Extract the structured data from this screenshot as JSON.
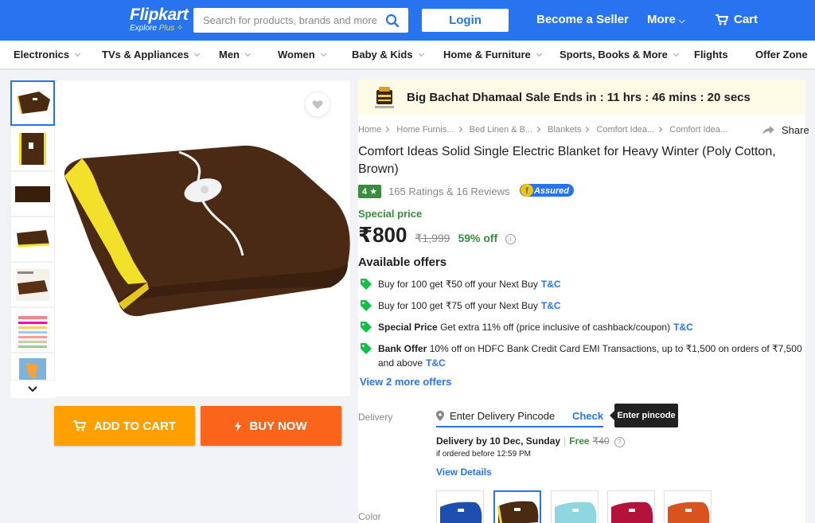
{
  "header": {
    "logo": "Flipkart",
    "logo_sub_explore": "Explore",
    "logo_sub_plus": "Plus",
    "search_placeholder": "Search for products, brands and more",
    "login": "Login",
    "become_seller": "Become a Seller",
    "more": "More",
    "cart": "Cart"
  },
  "categories": [
    "Electronics",
    "TVs & Appliances",
    "Men",
    "Women",
    "Baby & Kids",
    "Home & Furniture",
    "Sports, Books & More",
    "Flights",
    "Offer Zone"
  ],
  "product": {
    "sale_banner": "Big Bachat Dhamaal Sale Ends in : 11 hrs : 46 mins : 20 secs",
    "breadcrumbs": [
      "Home",
      "Home Furnis...",
      "Bed Linen & B...",
      "Blankets",
      "Comfort Idea...",
      "Comfort Idea..."
    ],
    "share": "Share",
    "title": "Comfort Ideas Solid Single Electric Blanket for Heavy Winter  (Poly Cotton, Brown)",
    "rating": "4",
    "rating_star": "★",
    "ratings_text": "165 Ratings & 16 Reviews",
    "assured": "Assured",
    "special_price_label": "Special price",
    "price": "₹800",
    "mrp": "₹1,999",
    "discount": "59% off",
    "info_glyph": "i"
  },
  "offers": {
    "heading": "Available offers",
    "items": [
      {
        "bold": "",
        "text": "Buy for 100 get ₹50 off your Next Buy",
        "link": "T&C"
      },
      {
        "bold": "",
        "text": "Buy for 100 get ₹75 off your Next Buy",
        "link": "T&C"
      },
      {
        "bold": "Special Price",
        "text": "Get extra 11% off (price inclusive of cashback/coupon)",
        "link": "T&C"
      },
      {
        "bold": "Bank Offer",
        "text": "10% off on HDFC Bank Credit Card EMI Transactions, up to ₹1,500 on orders of ₹7,500 and above",
        "link": "T&C"
      }
    ],
    "more": "View 2 more offers"
  },
  "delivery": {
    "label": "Delivery",
    "pincode_placeholder": "Enter Delivery Pincode",
    "check": "Check",
    "tooltip": "Enter pincode",
    "date_text": "Delivery by 10 Dec, Sunday",
    "separator": "|",
    "free": "Free",
    "free_strike": "₹40",
    "help_glyph": "?",
    "cutoff": "if ordered before 12:59 PM",
    "view_details": "View Details"
  },
  "color": {
    "label": "Color",
    "swatches": [
      "#1d4fb0",
      "#4b2a12",
      "#8fd6e0",
      "#b3123a",
      "#d9531e"
    ]
  },
  "buttons": {
    "add_to_cart": "ADD TO CART",
    "buy_now": "BUY NOW"
  },
  "colors": {
    "brand": "#2874f0",
    "add_to_cart": "#ff9f00",
    "buy_now": "#fb641b",
    "rating_green": "#388e3c",
    "blanket_brown": "#4b2a12",
    "blanket_trim": "#f2e02a"
  }
}
